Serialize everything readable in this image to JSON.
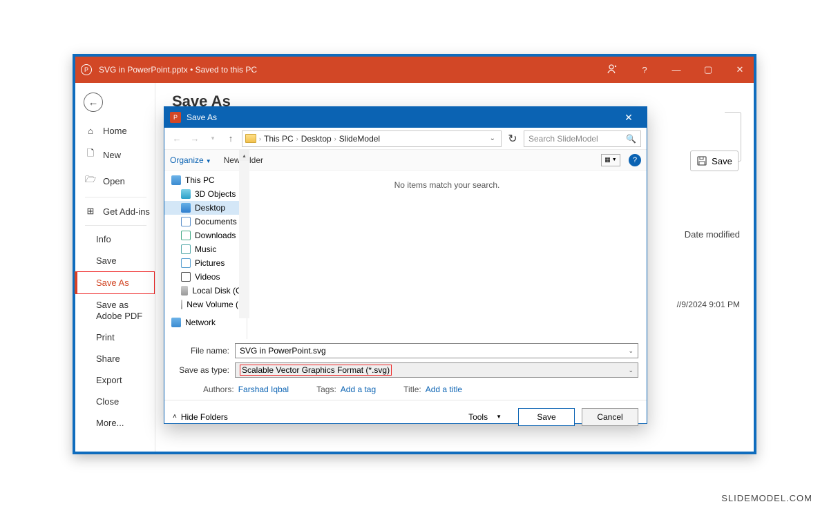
{
  "titlebar": {
    "file": "SVG in PowerPoint.pptx",
    "status": "Saved to this PC"
  },
  "sidebar": {
    "home": "Home",
    "new": "New",
    "open": "Open",
    "addins": "Get Add-ins",
    "items": [
      "Info",
      "Save",
      "Save As",
      "Save as Adobe PDF",
      "Print",
      "Share",
      "Export",
      "Close",
      "More..."
    ]
  },
  "page": {
    "title": "Save As",
    "save_btn": "Save",
    "date_mod_header": "Date modified",
    "date_mod_value": "//9/2024 9:01 PM"
  },
  "dialog": {
    "title": "Save As",
    "crumbs": [
      "This PC",
      "Desktop",
      "SlideModel"
    ],
    "search_placeholder": "Search SlideModel",
    "organize": "Organize",
    "new_folder": "New folder",
    "no_items": "No items match your search.",
    "tree": {
      "thispc": "This PC",
      "objects3d": "3D Objects",
      "desktop": "Desktop",
      "documents": "Documents",
      "downloads": "Downloads",
      "music": "Music",
      "pictures": "Pictures",
      "videos": "Videos",
      "localdisk": "Local Disk (C:)",
      "newvol": "New Volume (D:",
      "network": "Network"
    },
    "file_name_label": "File name:",
    "file_name": "SVG in PowerPoint.svg",
    "save_type_label": "Save as type:",
    "save_type": "Scalable Vector Graphics Format (*.svg)",
    "authors_label": "Authors:",
    "authors": "Farshad Iqbal",
    "tags_label": "Tags:",
    "tags": "Add a tag",
    "title_label": "Title:",
    "title_val": "Add a title",
    "hide_folders": "Hide Folders",
    "tools": "Tools",
    "save": "Save",
    "cancel": "Cancel"
  },
  "watermark": "SLIDEMODEL.COM"
}
